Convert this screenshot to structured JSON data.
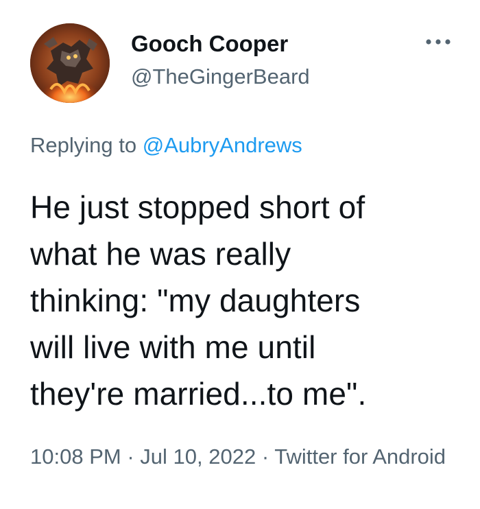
{
  "author": {
    "name": "Gooch Cooper",
    "handle": "@TheGingerBeard"
  },
  "reply_context": {
    "prefix": "Replying to",
    "mention": "@AubryAndrews"
  },
  "tweet_text_lines": [
    "He just stopped short of",
    "what he was really",
    "thinking: \"my daughters",
    "will live with me until",
    "they're married...to me\"."
  ],
  "metadata": {
    "time": "10:08 PM",
    "separator": "·",
    "date": "Jul 10, 2022",
    "source": "Twitter for Android"
  },
  "icons": {
    "more": "more-options-icon",
    "avatar": "user-avatar-image"
  },
  "colors": {
    "text_primary": "#0f1419",
    "text_secondary": "#536471",
    "link": "#1d9bf0",
    "background": "#ffffff"
  }
}
